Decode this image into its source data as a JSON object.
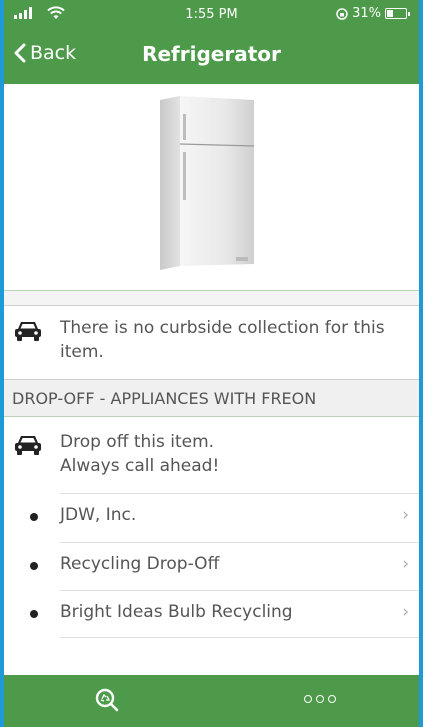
{
  "status": {
    "time": "1:55 PM",
    "battery": "31%"
  },
  "nav": {
    "back_label": "Back",
    "title": "Refrigerator"
  },
  "curbside": {
    "text": "There is no curbside collection for this item."
  },
  "dropoff": {
    "section_title": "DROP-OFF - APPLIANCES WITH FREON",
    "instruction": "Drop off this item. Always call ahead!",
    "locations": [
      {
        "name": "JDW, Inc."
      },
      {
        "name": "Recycling Drop-Off"
      },
      {
        "name": "Bright Ideas Bulb Recycling"
      }
    ]
  },
  "colors": {
    "brand_green": "#4d9a4a",
    "frame_blue": "#1e9bd7"
  },
  "icons": {
    "back": "chevron-left-icon",
    "car": "car-icon",
    "chevron": "chevron-right-icon",
    "search_tab": "recycle-search-icon",
    "more_tab": "more-icon"
  }
}
